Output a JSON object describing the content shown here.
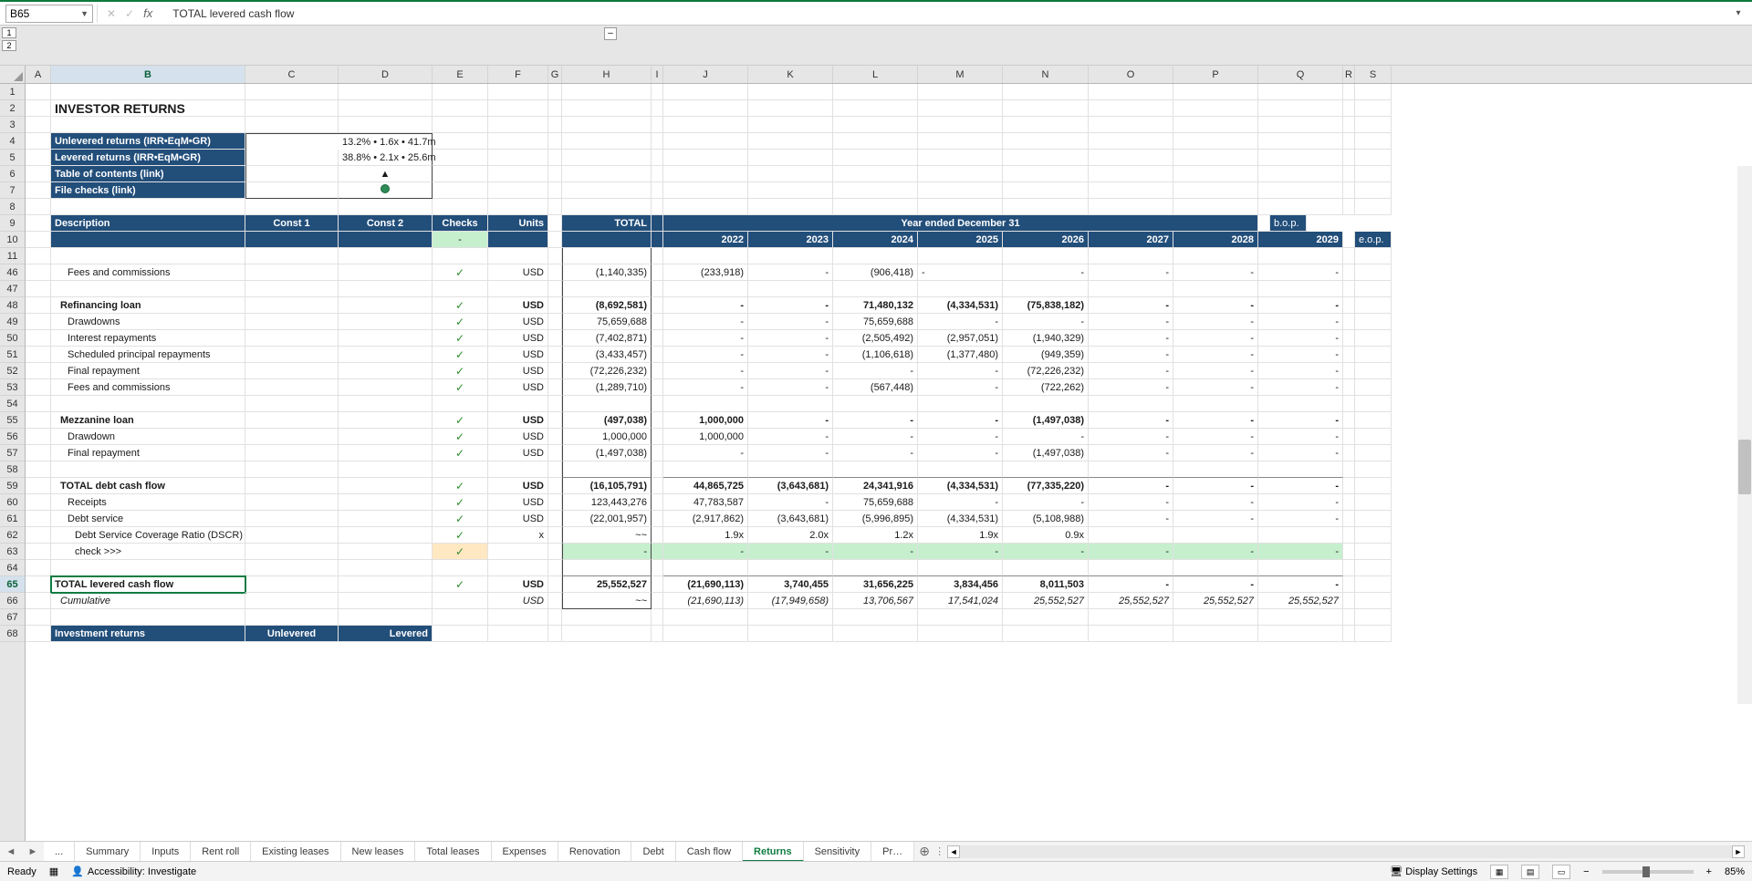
{
  "nameBox": "B65",
  "formulaText": "TOTAL levered cash flow",
  "outlineLevels": [
    "1",
    "2"
  ],
  "outlineToggle": "–",
  "columns": [
    "A",
    "B",
    "C",
    "D",
    "E",
    "F",
    "G",
    "H",
    "I",
    "J",
    "K",
    "L",
    "M",
    "N",
    "O",
    "P",
    "Q",
    "R",
    "S"
  ],
  "rowNumbers": [
    "1",
    "2",
    "3",
    "4",
    "5",
    "6",
    "7",
    "8",
    "9",
    "10",
    "11",
    "46",
    "47",
    "48",
    "49",
    "50",
    "51",
    "52",
    "53",
    "54",
    "55",
    "56",
    "57",
    "58",
    "59",
    "60",
    "61",
    "62",
    "63",
    "64",
    "65",
    "66",
    "67",
    "68"
  ],
  "selectedRow": "65",
  "selectedCol": "B",
  "title": "INVESTOR RETURNS",
  "kpi": {
    "unlevLabel": "Unlevered returns (IRR•EqM•GR)",
    "unlevVal": "13.2% • 1.6x • 41.7m",
    "levLabel": "Levered returns (IRR•EqM•GR)",
    "levVal": "38.8% • 2.1x • 25.6m",
    "tocLabel": "Table of contents (link)",
    "tocIcon": "▲",
    "checksLabel": "File checks (link)"
  },
  "hdr": {
    "desc": "Description",
    "c1": "Const 1",
    "c2": "Const 2",
    "checks": "Checks",
    "units": "Units",
    "total": "TOTAL",
    "yearEnded": "Year ended December 31",
    "y22": "2022",
    "y23": "2023",
    "y24": "2024",
    "y25": "2025",
    "y26": "2026",
    "y27": "2027",
    "y28": "2028",
    "y29": "2029",
    "bop": "b.o.p.",
    "eop": "e.o.p.",
    "dash": "-"
  },
  "rows": {
    "r46": {
      "label": "Fees and commissions",
      "units": "USD",
      "total": "(1,140,335)",
      "v": [
        "(233,918)",
        "-",
        "(906,418)",
        "-",
        "-",
        "-",
        "-",
        "-"
      ]
    },
    "r48": {
      "label": "Refinancing loan",
      "units": "USD",
      "total": "(8,692,581)",
      "v": [
        "-",
        "-",
        "71,480,132",
        "(4,334,531)",
        "(75,838,182)",
        "-",
        "-",
        "-"
      ]
    },
    "r49": {
      "label": "Drawdowns",
      "units": "USD",
      "total": "75,659,688",
      "v": [
        "-",
        "-",
        "75,659,688",
        "-",
        "-",
        "-",
        "-",
        "-"
      ]
    },
    "r50": {
      "label": "Interest repayments",
      "units": "USD",
      "total": "(7,402,871)",
      "v": [
        "-",
        "-",
        "(2,505,492)",
        "(2,957,051)",
        "(1,940,329)",
        "-",
        "-",
        "-"
      ]
    },
    "r51": {
      "label": "Scheduled principal repayments",
      "units": "USD",
      "total": "(3,433,457)",
      "v": [
        "-",
        "-",
        "(1,106,618)",
        "(1,377,480)",
        "(949,359)",
        "-",
        "-",
        "-"
      ]
    },
    "r52": {
      "label": "Final repayment",
      "units": "USD",
      "total": "(72,226,232)",
      "v": [
        "-",
        "-",
        "-",
        "-",
        "(72,226,232)",
        "-",
        "-",
        "-"
      ]
    },
    "r53": {
      "label": "Fees and commissions",
      "units": "USD",
      "total": "(1,289,710)",
      "v": [
        "-",
        "-",
        "(567,448)",
        "-",
        "(722,262)",
        "-",
        "-",
        "-"
      ]
    },
    "r55": {
      "label": "Mezzanine loan",
      "units": "USD",
      "total": "(497,038)",
      "v": [
        "1,000,000",
        "-",
        "-",
        "-",
        "(1,497,038)",
        "-",
        "-",
        "-"
      ]
    },
    "r56": {
      "label": "Drawdown",
      "units": "USD",
      "total": "1,000,000",
      "v": [
        "1,000,000",
        "-",
        "-",
        "-",
        "-",
        "-",
        "-",
        "-"
      ]
    },
    "r57": {
      "label": "Final repayment",
      "units": "USD",
      "total": "(1,497,038)",
      "v": [
        "-",
        "-",
        "-",
        "-",
        "(1,497,038)",
        "-",
        "-",
        "-"
      ]
    },
    "r59": {
      "label": "TOTAL debt cash flow",
      "units": "USD",
      "total": "(16,105,791)",
      "v": [
        "44,865,725",
        "(3,643,681)",
        "24,341,916",
        "(4,334,531)",
        "(77,335,220)",
        "-",
        "-",
        "-"
      ]
    },
    "r60": {
      "label": "Receipts",
      "units": "USD",
      "total": "123,443,276",
      "v": [
        "47,783,587",
        "-",
        "75,659,688",
        "-",
        "-",
        "-",
        "-",
        "-"
      ]
    },
    "r61": {
      "label": "Debt service",
      "units": "USD",
      "total": "(22,001,957)",
      "v": [
        "(2,917,862)",
        "(3,643,681)",
        "(5,996,895)",
        "(4,334,531)",
        "(5,108,988)",
        "-",
        "-",
        "-"
      ]
    },
    "r62": {
      "label": "Debt Service Coverage Ratio (DSCR)",
      "units": "x",
      "total": "~~",
      "v": [
        "1.9x",
        "2.0x",
        "1.2x",
        "1.9x",
        "0.9x",
        "",
        "",
        ""
      ]
    },
    "r63": {
      "label": "check >>>",
      "total": "-",
      "v": [
        "-",
        "-",
        "-",
        "-",
        "-",
        "-",
        "-",
        "-"
      ]
    },
    "r65": {
      "label": "TOTAL levered cash flow",
      "units": "USD",
      "total": "25,552,527",
      "v": [
        "(21,690,113)",
        "3,740,455",
        "31,656,225",
        "3,834,456",
        "8,011,503",
        "-",
        "-",
        "-"
      ]
    },
    "r66": {
      "label": "Cumulative",
      "units": "USD",
      "total": "~~",
      "v": [
        "(21,690,113)",
        "(17,949,658)",
        "13,706,567",
        "17,541,024",
        "25,552,527",
        "25,552,527",
        "25,552,527",
        "25,552,527"
      ]
    },
    "r68": {
      "label": "Investment returns",
      "c1": "Unlevered",
      "c2": "Levered"
    }
  },
  "check": "✓",
  "sheetTabs": {
    "prev": "...",
    "list": [
      "Summary",
      "Inputs",
      "Rent roll",
      "Existing leases",
      "New leases",
      "Total leases",
      "Expenses",
      "Renovation",
      "Debt",
      "Cash flow",
      "Returns",
      "Sensitivity",
      "Pr…"
    ],
    "active": "Returns"
  },
  "status": {
    "ready": "Ready",
    "accessibility": "Accessibility: Investigate",
    "display": "Display Settings",
    "zoom": "85%"
  }
}
